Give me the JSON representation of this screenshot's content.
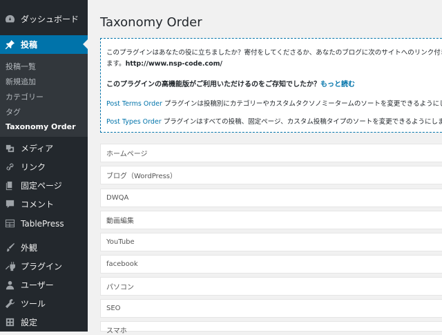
{
  "sidebar": {
    "dashboard": "ダッシュボード",
    "posts": "投稿",
    "submenu": [
      "投稿一覧",
      "新規追加",
      "カテゴリー",
      "タグ",
      "Taxonomy Order"
    ],
    "media": "メディア",
    "links": "リンク",
    "pages": "固定ページ",
    "comments": "コメント",
    "tablepress": "TablePress",
    "appearance": "外観",
    "plugins": "プラグイン",
    "users": "ユーザー",
    "tools": "ツール",
    "settings": "設定"
  },
  "main": {
    "title": "Taxonomy Order",
    "info": {
      "line1": "このプラグインはあなたの役に立ちましたか？寄付をしてくださるか、あなたのブログに次のサイトへのリンク付きで",
      "line2_prefix": "ます。",
      "line2_url": "http://www.nsp-code.com/",
      "pro_text": "このプラグインの高機能版がご利用いただけるのをご存知でしたか？",
      "pro_link": "もっと読む",
      "pto_link": "Post Terms Order",
      "pto_text": "プラグインは投稿別にカテゴリーやカスタムタクソノミータームのソートを変更できるようにします",
      "ptypes_link": "Post Types Order",
      "ptypes_text": "プラグインはすべての投稿、固定ページ、カスタム投稿タイプのソートを変更できるようにします"
    },
    "terms": [
      "ホームページ",
      "ブログ（WordPress）",
      "DWQA",
      "動画編集",
      "YouTube",
      "facebook",
      "パソコン",
      "SEO",
      "スマホ"
    ]
  },
  "colors": {
    "sidebar_bg": "#23282d",
    "accent": "#0073aa",
    "page_bg": "#f1f1f1"
  }
}
